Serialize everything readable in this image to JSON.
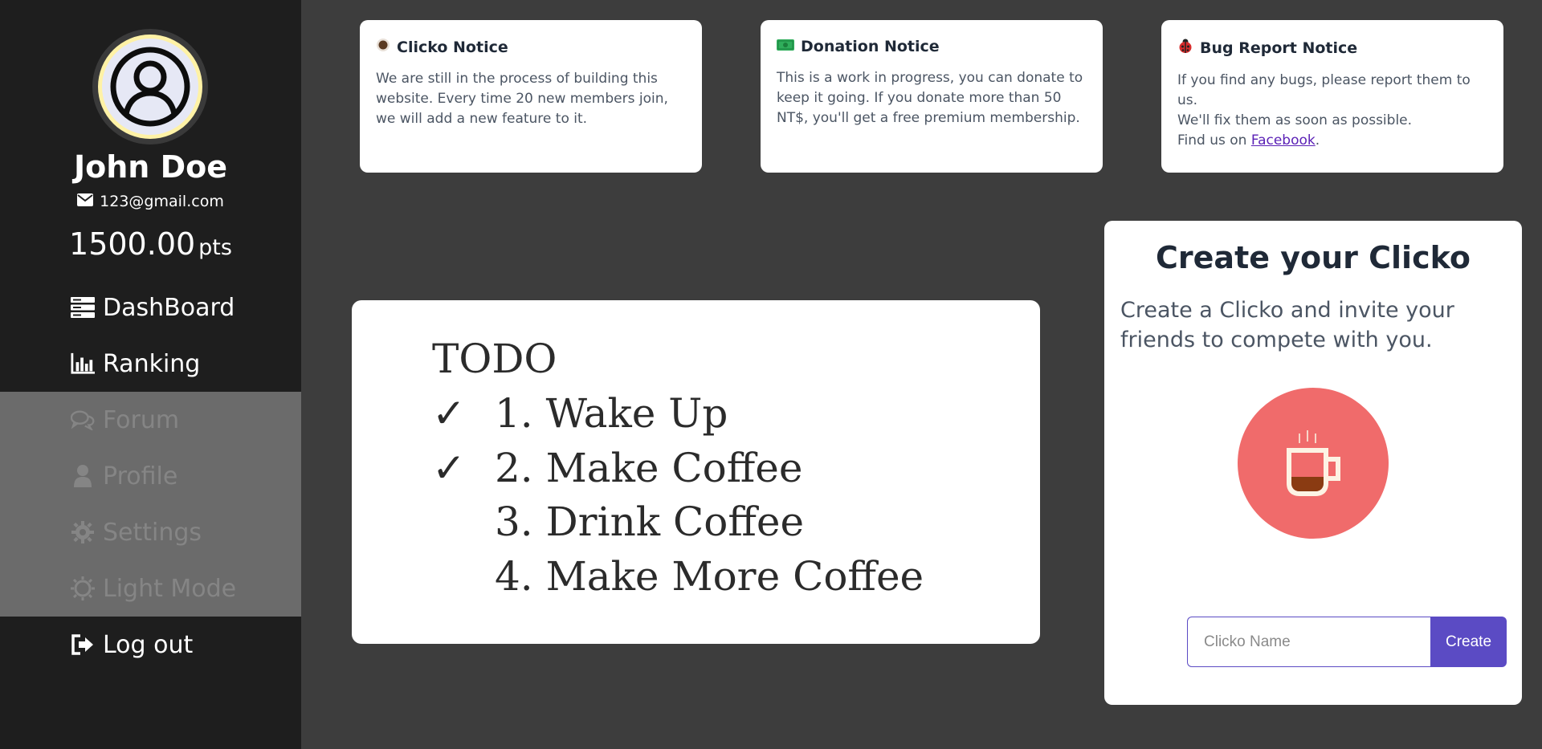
{
  "user": {
    "name": "John Doe",
    "email": "123@gmail.com",
    "points": "1500.00",
    "points_unit": "pts"
  },
  "nav": {
    "dashboard": "DashBoard",
    "ranking": "Ranking",
    "forum": "Forum",
    "profile": "Profile",
    "settings": "Settings",
    "light_mode": "Light Mode",
    "logout": "Log out"
  },
  "notices": [
    {
      "icon": "coffee-icon",
      "title": "Clicko Notice",
      "body": "We are still in the process of building this website. Every time 20 new members join, we will add a new feature to it."
    },
    {
      "icon": "money-icon",
      "title": "Donation Notice",
      "body": "This is a work in progress, you can donate to keep it going. If you donate more than 50 NT$, you'll get a free premium membership."
    },
    {
      "icon": "ladybug-icon",
      "title": "Bug Report Notice",
      "body_line1": "If you find any bugs, please report them to us.",
      "body_line2": "We'll fix them as soon as possible.",
      "body_line3_prefix": "Find us on ",
      "link": "Facebook",
      "body_line3_suffix": "."
    }
  ],
  "todo": {
    "title": "TODO",
    "items": [
      {
        "check": "✓",
        "text": "1. Wake Up"
      },
      {
        "check": "✓",
        "text": "2. Make Coffee"
      },
      {
        "check": "",
        "text": "3. Drink Coffee"
      },
      {
        "check": "",
        "text": "4. Make More Coffee"
      }
    ]
  },
  "create": {
    "title": "Create your Clicko",
    "description": "Create a Clicko and invite your friends to compete with you.",
    "input_placeholder": "Clicko Name",
    "button": "Create"
  },
  "colors": {
    "sidebar": "#1e1e1e",
    "background": "#3d3d3d",
    "accent": "#5b4bc4",
    "coffee_circle": "#f06b6b"
  }
}
